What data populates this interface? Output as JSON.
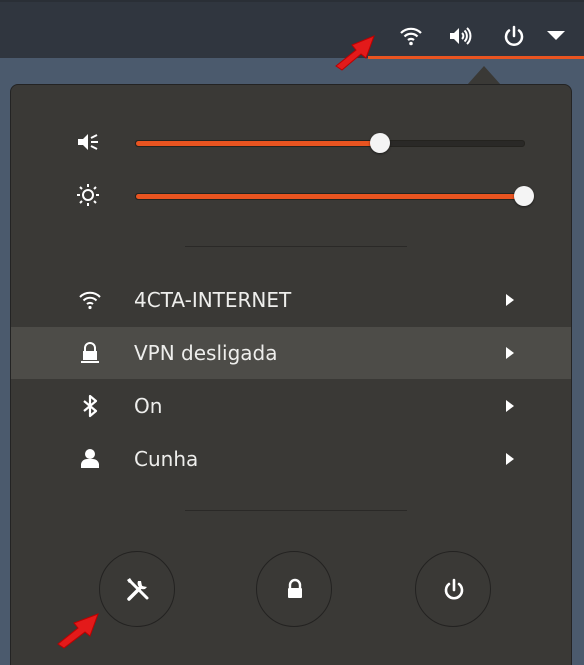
{
  "topbar": {
    "icons": [
      "wifi-icon",
      "volume-icon",
      "power-icon",
      "chevron-down-icon"
    ]
  },
  "menu": {
    "volume": {
      "icon": "volume-icon",
      "level": 0.63
    },
    "brightness": {
      "icon": "brightness-icon",
      "level": 1.0
    },
    "items": [
      {
        "icon": "wifi-icon",
        "label": "4CTA-INTERNET"
      },
      {
        "icon": "vpn-icon",
        "label": "VPN desligada"
      },
      {
        "icon": "bluetooth-icon",
        "label": "On"
      },
      {
        "icon": "user-icon",
        "label": "Cunha"
      }
    ],
    "buttons": [
      "settings-icon",
      "lock-icon",
      "power-icon"
    ]
  },
  "colors": {
    "accent": "#e95420",
    "menu_bg": "#3a3936",
    "topbar_bg": "#30363f",
    "annotation_arrow": "#e31a1a"
  }
}
